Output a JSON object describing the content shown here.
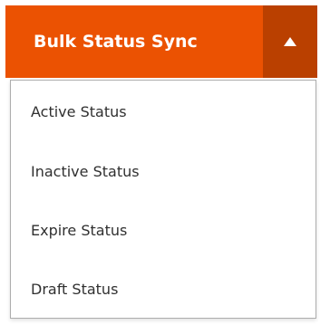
{
  "split_button": {
    "label": "Bulk Status Sync",
    "toggle_icon": "caret-up-icon",
    "colors": {
      "primary": "#eb5202",
      "toggle": "#ba4000",
      "text": "#ffffff"
    }
  },
  "menu": {
    "items": [
      {
        "label": "Active Status"
      },
      {
        "label": "Inactive Status"
      },
      {
        "label": "Expire Status"
      },
      {
        "label": "Draft Status"
      }
    ]
  }
}
